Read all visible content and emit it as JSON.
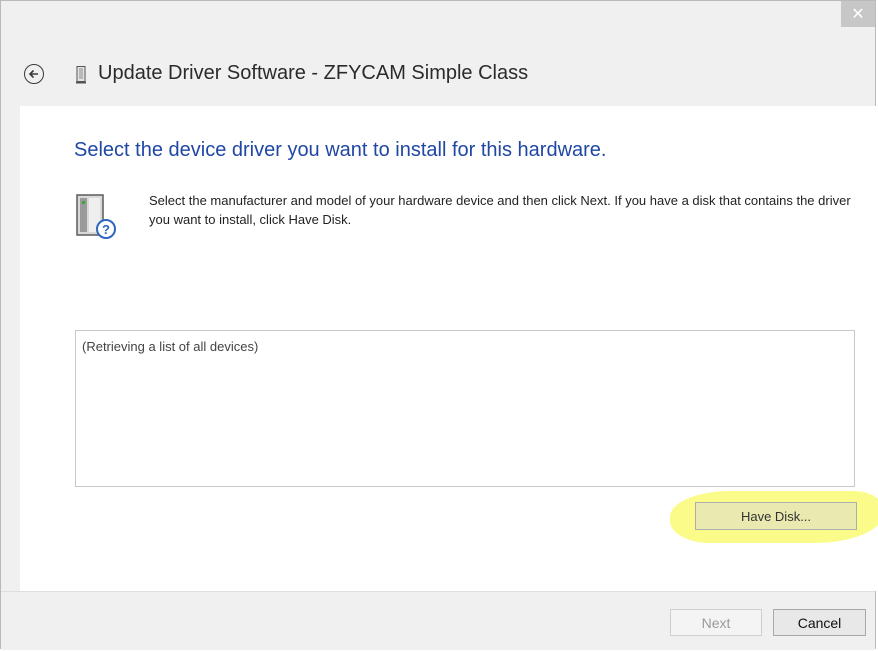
{
  "window": {
    "title": "Update Driver Software - ZFYCAM Simple Class",
    "close_symbol": "✕"
  },
  "icons": {
    "back": "back-arrow-icon",
    "title": "device-icon",
    "hardware": "hardware-question-icon",
    "close": "close-icon"
  },
  "main": {
    "heading": "Select the device driver you want to install for this hardware.",
    "description": "Select the manufacturer and model of your hardware device and then click Next. If you have a disk that contains the driver you want to install, click Have Disk.",
    "list_status": "(Retrieving a list of all devices)",
    "have_disk_label": "Have Disk..."
  },
  "footer": {
    "next_label": "Next",
    "cancel_label": "Cancel"
  },
  "colors": {
    "heading": "#1f47a3",
    "highlight": "#fbfb83"
  }
}
